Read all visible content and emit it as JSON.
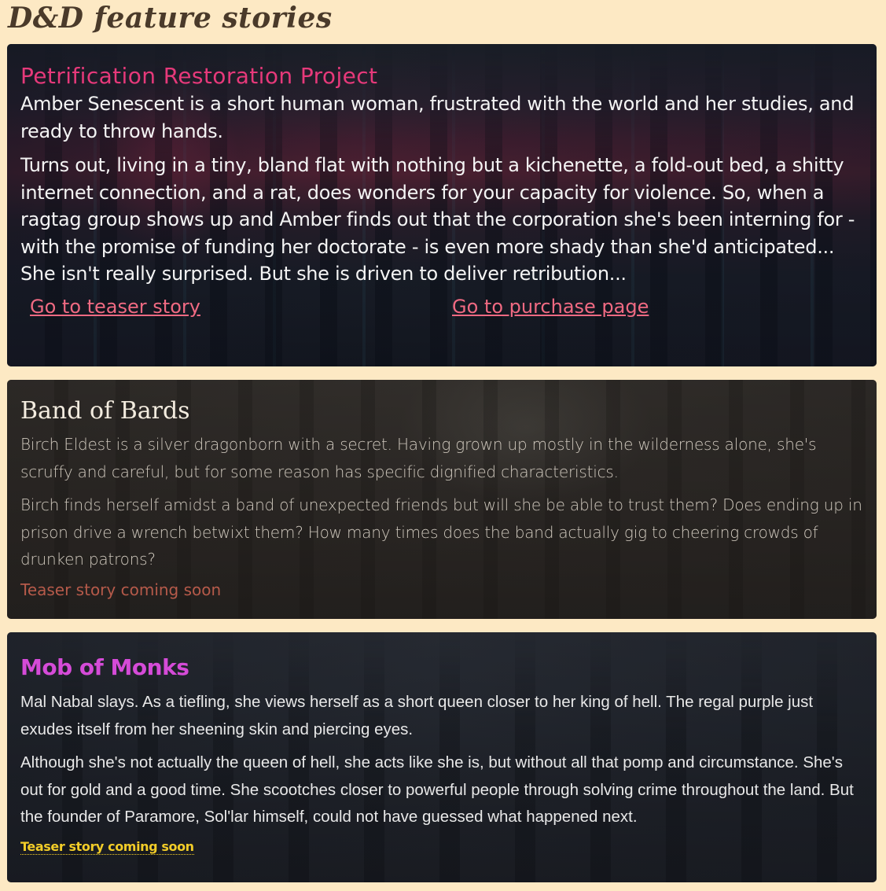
{
  "page": {
    "title": "D&D feature stories"
  },
  "stories": [
    {
      "title": "Petrification Restoration Project",
      "paragraph1": "Amber Senescent is a short human woman, frustrated with the world and her studies, and ready to throw hands.",
      "paragraph2": "Turns out, living in a tiny, bland flat with nothing but a kichenette, a fold-out bed, a shitty internet connection, and a rat, does wonders for your capacity for violence. So, when a ragtag group shows up and Amber finds out that the corporation she's been interning for - with the promise of funding her doctorate - is even more shady than she'd anticipated...",
      "paragraph3": "She isn't really surprised. But she is driven to deliver retribution...",
      "teaser_link": "Go to teaser story",
      "purchase_link": "Go to purchase page",
      "title_color": "#e6397a"
    },
    {
      "title": "Band of Bards",
      "paragraph1": "Birch Eldest is a silver dragonborn with a secret. Having grown up mostly in the wilderness alone, she's scruffy and careful, but for some reason has specific dignified characteristics.",
      "paragraph2": "Birch finds herself amidst a band of unexpected friends but will she be able to trust them? Does ending up in prison drive a wrench betwixt them? How many times does the band actually gig to cheering crowds of drunken patrons?",
      "status": "Teaser story coming soon",
      "title_color": "#f3ecdf"
    },
    {
      "title": "Mob of Monks",
      "paragraph1": "Mal Nabal slays. As a tiefling, she views herself as a short queen closer to her king of hell. The regal purple just exudes itself from her sheening skin and piercing eyes.",
      "paragraph2": "Although she's not actually the queen of hell, she acts like she is, but without all that pomp and circumstance. She's out for gold and a good time. She scootches closer to powerful people through solving crime throughout the land. But the founder of Paramore, Sol'lar himself, could not have guessed what happened next.",
      "status": "Teaser story coming soon",
      "title_color": "#d54bd8"
    }
  ]
}
